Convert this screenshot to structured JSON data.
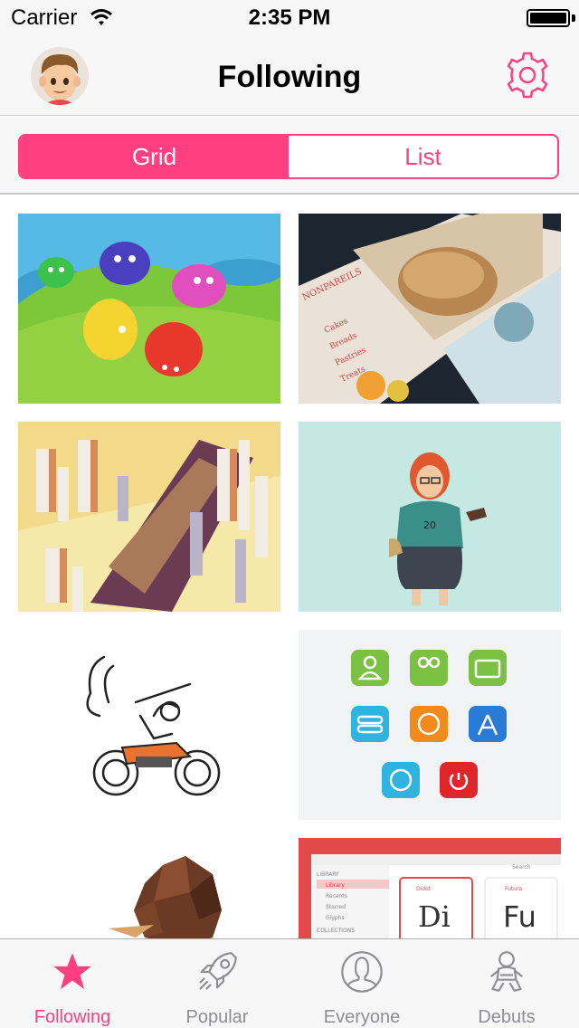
{
  "status_bar": {
    "carrier": "Carrier",
    "time": "2:35 PM",
    "battery_level": 1.0
  },
  "nav": {
    "title": "Following",
    "avatar_icon": "user-avatar",
    "settings_icon": "gear-icon"
  },
  "segmented": {
    "items": [
      "Grid",
      "List"
    ],
    "selected": "Grid",
    "accent": "#ff3f7f"
  },
  "shots": [
    {
      "name": "shot-blob-creatures"
    },
    {
      "name": "shot-nonpareils-menu",
      "texts": {
        "brand": "NONPAREILS",
        "a": "Cakes",
        "b": "Breads",
        "c": "Pastries",
        "d": "Treats"
      }
    },
    {
      "name": "shot-isometric-city"
    },
    {
      "name": "shot-redhead-illustration",
      "texts": {
        "shirt": "20"
      }
    },
    {
      "name": "shot-skeleton-motorcycle"
    },
    {
      "name": "shot-app-icons"
    },
    {
      "name": "shot-chocolate-cone"
    },
    {
      "name": "shot-font-app-ui",
      "texts": {
        "lib": "LIBRARY",
        "l1": "Library",
        "l2": "Recents",
        "l3": "Starred",
        "l4": "Glyphs",
        "l5": "COLLECTIONS",
        "g1": "Di",
        "g2": "Fu",
        "cap1": "Didot",
        "cap2": "Futura",
        "search": "Search"
      }
    }
  ],
  "tabs": [
    {
      "label": "Following",
      "icon": "star-icon",
      "active": true
    },
    {
      "label": "Popular",
      "icon": "rocket-icon",
      "active": false
    },
    {
      "label": "Everyone",
      "icon": "person-icon",
      "active": false
    },
    {
      "label": "Debuts",
      "icon": "baby-icon",
      "active": false
    }
  ]
}
